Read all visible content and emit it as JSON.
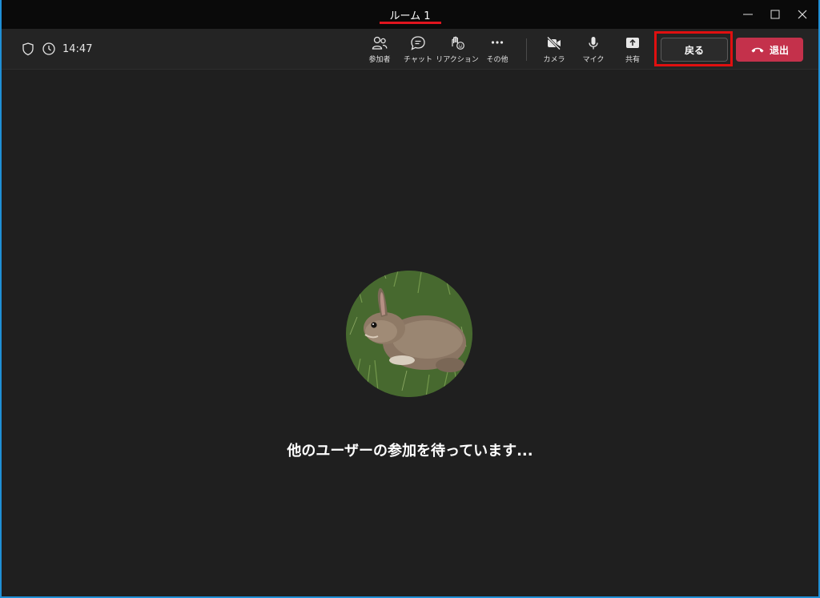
{
  "window": {
    "title": "ルーム 1"
  },
  "toolbar": {
    "time": "14:47",
    "participants_label": "参加者",
    "chat_label": "チャット",
    "reactions_label": "リアクション",
    "more_label": "その他",
    "camera_label": "カメラ",
    "mic_label": "マイク",
    "share_label": "共有",
    "back_label": "戻る",
    "leave_label": "退出"
  },
  "stage": {
    "waiting_message": "他のユーザーの参加を待っています..."
  },
  "colors": {
    "background": "#1f1f1f",
    "toolbar": "#242424",
    "leave": "#c4314b",
    "highlight": "#e01010"
  }
}
